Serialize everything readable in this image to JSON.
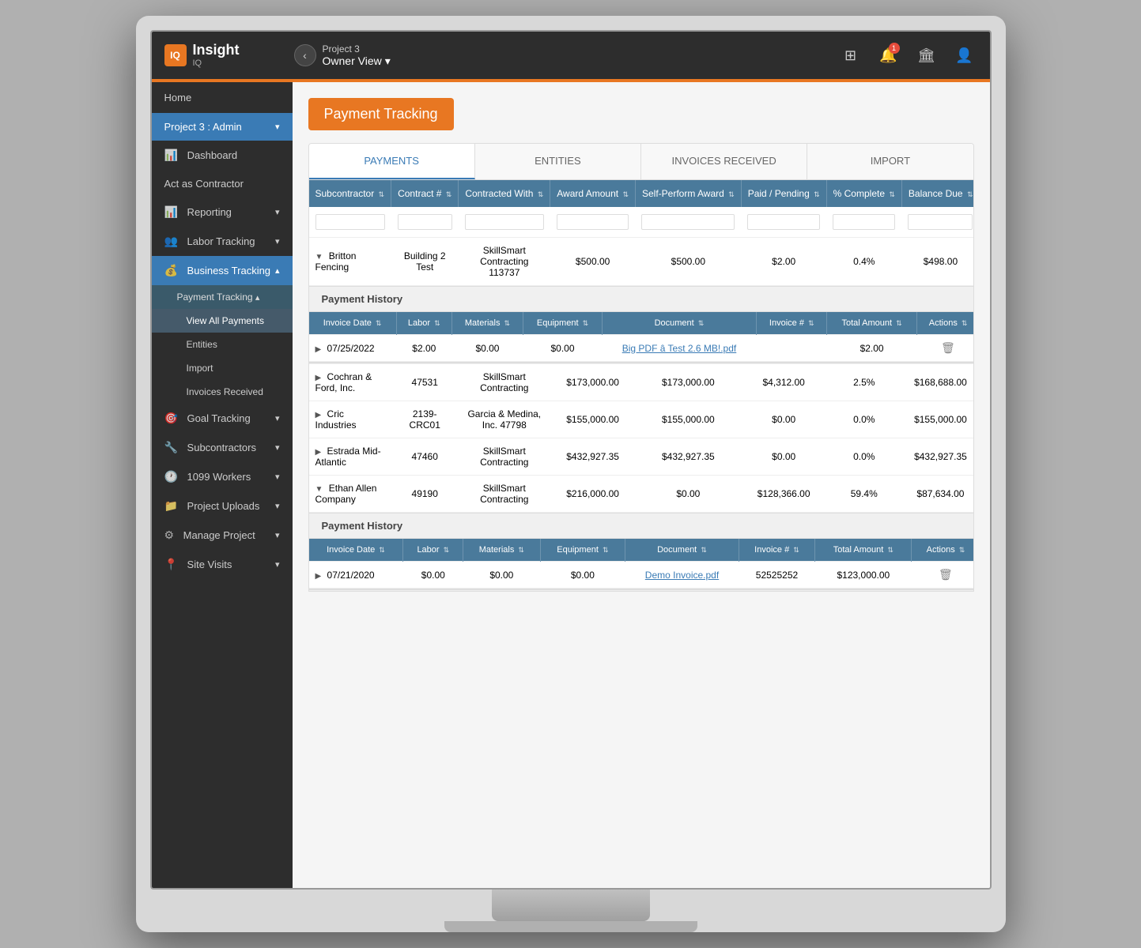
{
  "app": {
    "logo_text": "Insight",
    "logo_sub": "IQ",
    "logo_icon": "IQ"
  },
  "topbar": {
    "project_name": "Project 3",
    "view_label": "Owner View",
    "back_icon": "‹",
    "chevron_icon": "▾",
    "grid_icon": "⊞",
    "notification_icon": "🔔",
    "notification_count": "1",
    "building_icon": "🏛",
    "user_icon": "👤"
  },
  "sidebar": {
    "home_label": "Home",
    "section_label": "Project 3 : Admin",
    "dashboard_label": "Dashboard",
    "act_as": "Act as Contractor",
    "items": [
      {
        "label": "Reporting",
        "icon": "📊",
        "has_sub": true
      },
      {
        "label": "Labor Tracking",
        "icon": "👥",
        "has_sub": true
      },
      {
        "label": "Business Tracking",
        "icon": "💰",
        "has_sub": true,
        "active": true
      },
      {
        "label": "Payment Tracking",
        "sub_active": true
      },
      {
        "label": "View All Payments",
        "sub": true,
        "active": true
      },
      {
        "label": "Entities",
        "sub": true
      },
      {
        "label": "Import",
        "sub": true
      },
      {
        "label": "Invoices Received",
        "sub": true
      },
      {
        "label": "Goal Tracking",
        "icon": "🎯",
        "has_sub": true
      },
      {
        "label": "Subcontractors",
        "icon": "🔧",
        "has_sub": true
      },
      {
        "label": "1099 Workers",
        "icon": "🕐",
        "has_sub": true
      },
      {
        "label": "Project Uploads",
        "icon": "📁",
        "has_sub": true
      },
      {
        "label": "Manage Project",
        "icon": "⚙",
        "has_sub": true
      },
      {
        "label": "Site Visits",
        "icon": "📍",
        "has_sub": true
      }
    ]
  },
  "page": {
    "title": "Payment Tracking",
    "tabs": [
      {
        "label": "PAYMENTS",
        "active": true
      },
      {
        "label": "ENTITIES",
        "active": false
      },
      {
        "label": "INVOICES RECEIVED",
        "active": false
      },
      {
        "label": "IMPORT",
        "active": false
      }
    ]
  },
  "table": {
    "headers": [
      "Subcontractor",
      "Contract #",
      "Contracted With",
      "Award Amount",
      "Self-Perform Award",
      "Paid / Pending",
      "% Complete",
      "Balance Due"
    ],
    "rows": [
      {
        "id": "britton",
        "subcontractor": "Britton Fencing",
        "contract": "Building 2 Test",
        "contracted_with": "SkillSmart Contracting 113737",
        "award_amount": "$500.00",
        "self_perform": "$500.00",
        "paid_pending": "$2.00",
        "pct_complete": "0.4%",
        "balance_due": "$498.00",
        "expanded": true,
        "payment_history": [
          {
            "invoice_date": "07/25/2022",
            "labor": "$2.00",
            "materials": "$0.00",
            "equipment": "$0.00",
            "document": "Big PDF â Test 2.6 MB!.pdf",
            "invoice_num": "",
            "total_amount": "$2.00",
            "has_delete": true
          }
        ]
      },
      {
        "id": "cochran",
        "subcontractor": "Cochran & Ford, Inc.",
        "contract": "47531",
        "contracted_with": "SkillSmart Contracting",
        "award_amount": "$173,000.00",
        "self_perform": "$173,000.00",
        "paid_pending": "$4,312.00",
        "pct_complete": "2.5%",
        "balance_due": "$168,688.00",
        "expanded": false,
        "payment_history": []
      },
      {
        "id": "cric",
        "subcontractor": "Cric Industries",
        "contract": "2139-CRC01",
        "contracted_with": "Garcia & Medina, Inc. 47798",
        "award_amount": "$155,000.00",
        "self_perform": "$155,000.00",
        "paid_pending": "$0.00",
        "pct_complete": "0.0%",
        "balance_due": "$155,000.00",
        "expanded": false,
        "payment_history": []
      },
      {
        "id": "estrada",
        "subcontractor": "Estrada Mid-Atlantic",
        "contract": "47460",
        "contracted_with": "SkillSmart Contracting",
        "award_amount": "$432,927.35",
        "self_perform": "$432,927.35",
        "paid_pending": "$0.00",
        "pct_complete": "0.0%",
        "balance_due": "$432,927.35",
        "expanded": false,
        "payment_history": []
      },
      {
        "id": "ethan",
        "subcontractor": "Ethan Allen Company",
        "contract": "49190",
        "contracted_with": "SkillSmart Contracting",
        "award_amount": "$216,000.00",
        "self_perform": "$0.00",
        "paid_pending": "$128,366.00",
        "pct_complete": "59.4%",
        "balance_due": "$87,634.00",
        "expanded": true,
        "payment_history": [
          {
            "invoice_date": "07/21/2020",
            "labor": "$0.00",
            "materials": "$0.00",
            "equipment": "$0.00",
            "document": "Demo Invoice.pdf",
            "invoice_num": "52525252",
            "total_amount": "$123,000.00",
            "has_delete": true
          }
        ]
      }
    ],
    "sub_headers": [
      "Invoice Date",
      "Labor",
      "Materials",
      "Equipment",
      "Document",
      "Invoice #",
      "Total Amount",
      "Actions"
    ]
  }
}
